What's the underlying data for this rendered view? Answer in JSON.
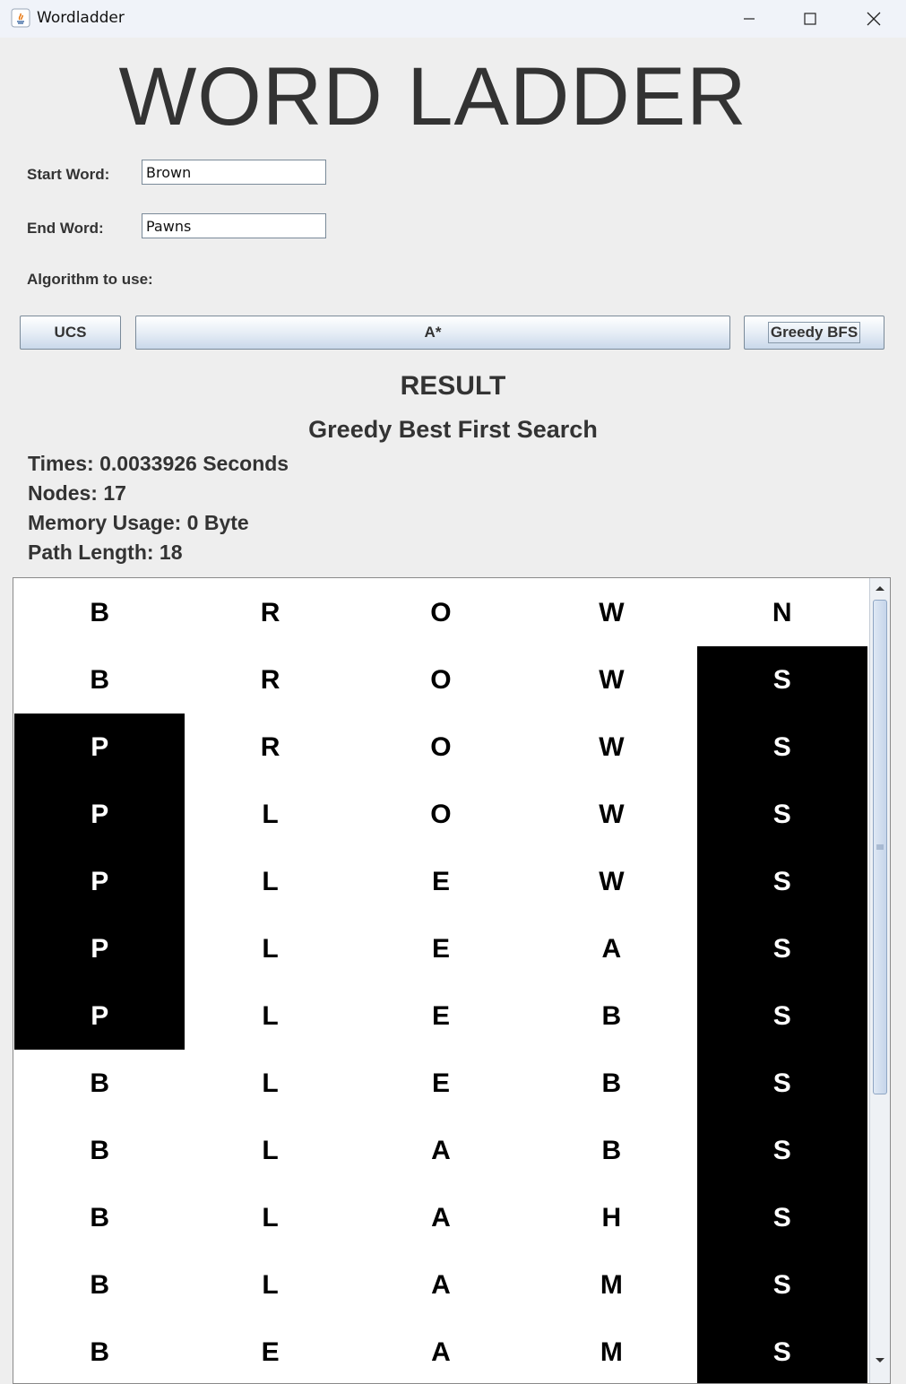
{
  "window": {
    "title": "Wordladder"
  },
  "app": {
    "heading": "WORD LADDER"
  },
  "form": {
    "start_label": "Start Word:",
    "start_value": "Brown",
    "end_label": "End Word:",
    "end_value": "Pawns",
    "algorithm_label": "Algorithm to use:"
  },
  "buttons": {
    "ucs": "UCS",
    "astar": "A*",
    "gbfs": "Greedy BFS"
  },
  "result": {
    "title": "RESULT",
    "algorithm": "Greedy Best First Search",
    "times": "Times: 0.0033926 Seconds",
    "nodes": "Nodes: 17",
    "memory": "Memory Usage: 0 Byte",
    "path_length": "Path Length: 18"
  },
  "ladder": {
    "highlight_color": "#000000",
    "rows": [
      {
        "letters": [
          "B",
          "R",
          "O",
          "W",
          "N"
        ],
        "highlight": [
          false,
          false,
          false,
          false,
          false
        ]
      },
      {
        "letters": [
          "B",
          "R",
          "O",
          "W",
          "S"
        ],
        "highlight": [
          false,
          false,
          false,
          false,
          true
        ]
      },
      {
        "letters": [
          "P",
          "R",
          "O",
          "W",
          "S"
        ],
        "highlight": [
          true,
          false,
          false,
          false,
          true
        ]
      },
      {
        "letters": [
          "P",
          "L",
          "O",
          "W",
          "S"
        ],
        "highlight": [
          true,
          false,
          false,
          false,
          true
        ]
      },
      {
        "letters": [
          "P",
          "L",
          "E",
          "W",
          "S"
        ],
        "highlight": [
          true,
          false,
          false,
          false,
          true
        ]
      },
      {
        "letters": [
          "P",
          "L",
          "E",
          "A",
          "S"
        ],
        "highlight": [
          true,
          false,
          false,
          false,
          true
        ]
      },
      {
        "letters": [
          "P",
          "L",
          "E",
          "B",
          "S"
        ],
        "highlight": [
          true,
          false,
          false,
          false,
          true
        ]
      },
      {
        "letters": [
          "B",
          "L",
          "E",
          "B",
          "S"
        ],
        "highlight": [
          false,
          false,
          false,
          false,
          true
        ]
      },
      {
        "letters": [
          "B",
          "L",
          "A",
          "B",
          "S"
        ],
        "highlight": [
          false,
          false,
          false,
          false,
          true
        ]
      },
      {
        "letters": [
          "B",
          "L",
          "A",
          "H",
          "S"
        ],
        "highlight": [
          false,
          false,
          false,
          false,
          true
        ]
      },
      {
        "letters": [
          "B",
          "L",
          "A",
          "M",
          "S"
        ],
        "highlight": [
          false,
          false,
          false,
          false,
          true
        ]
      },
      {
        "letters": [
          "B",
          "E",
          "A",
          "M",
          "S"
        ],
        "highlight": [
          false,
          false,
          false,
          false,
          true
        ]
      }
    ]
  }
}
